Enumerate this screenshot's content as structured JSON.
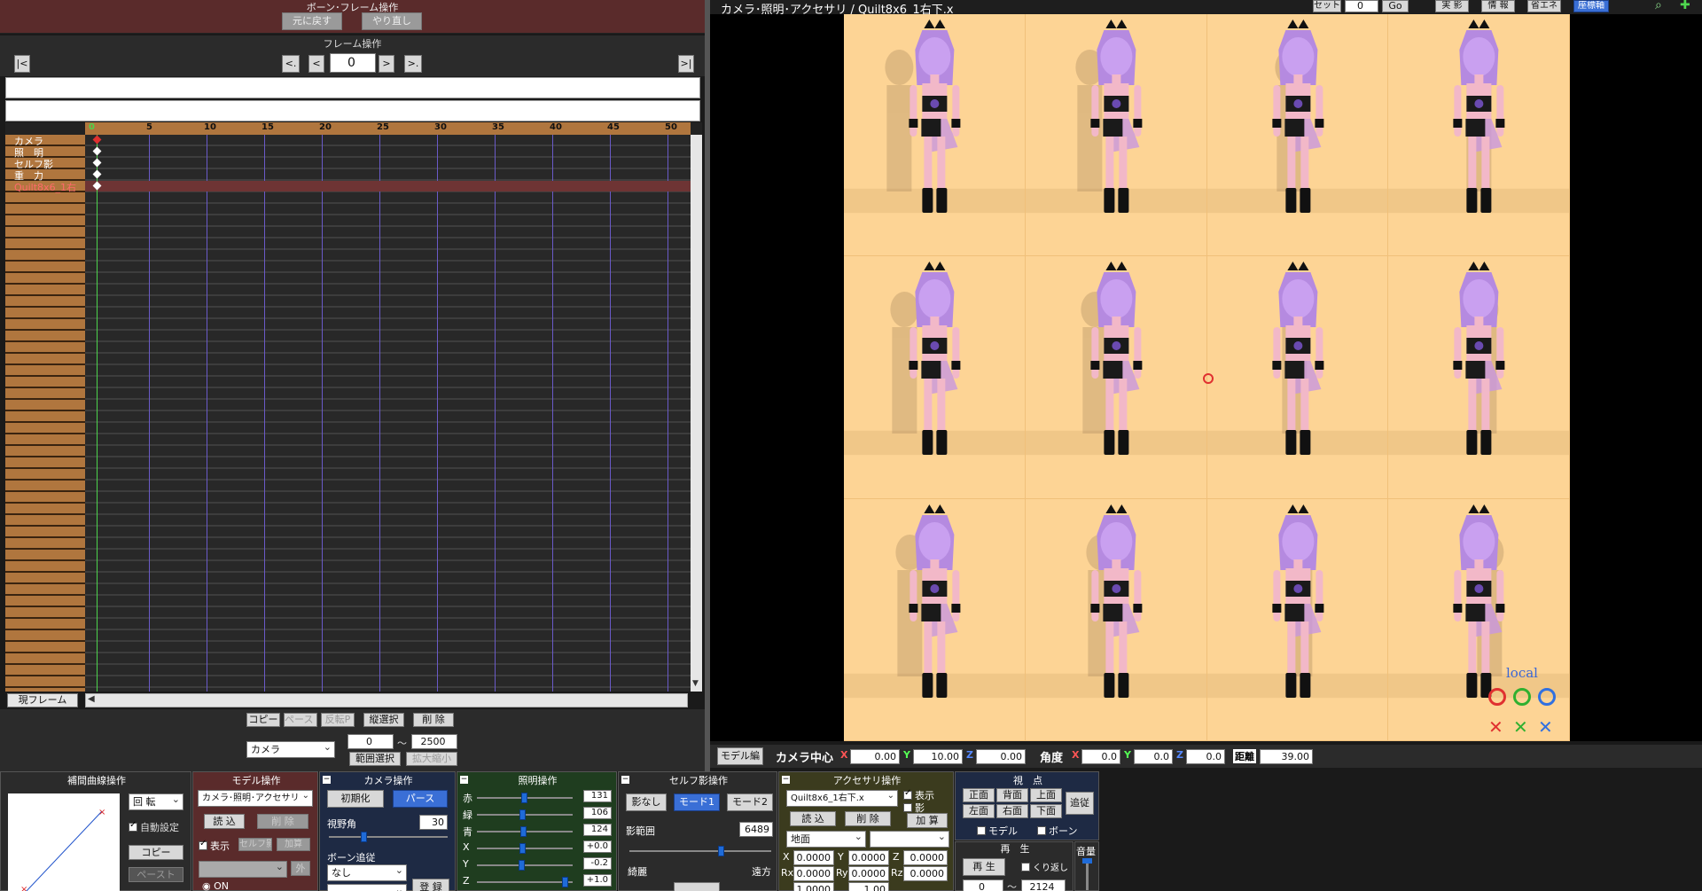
{
  "bone_frame_ops": {
    "title": "ボーン･フレーム操作",
    "undo": "元に戻す",
    "redo": "やり直し"
  },
  "frame_ops": {
    "title": "フレーム操作",
    "first": "|<",
    "prev_key": "<.",
    "prev": "<",
    "frame": "0",
    "next": ">",
    "next_key": ">.",
    "last": ">|"
  },
  "timeline": {
    "ruler": [
      "0",
      "5",
      "10",
      "15",
      "20",
      "25",
      "30",
      "35",
      "40",
      "45",
      "50"
    ],
    "tracks": [
      "カメラ",
      "照　明",
      "セルフ影",
      "重　力",
      "Quilt8x6_1右"
    ],
    "current_frame_label": "現フレーム"
  },
  "timeline_buttons": {
    "copy": "コピー",
    "paste": "ペースト",
    "invert_paste": "反転P",
    "vertical_select": "縦選択",
    "delete": "削 除",
    "target": "カメラ",
    "range_start": "0",
    "tilde": "〜",
    "range_end": "2500",
    "range_select": "範囲選択",
    "scale": "拡大縮小"
  },
  "viewport": {
    "title": "カメラ･照明･アクセサリ / Quilt8x6_1右下.x",
    "set_label": "セット",
    "set_value": "0",
    "go": "Go",
    "buttons": [
      "実 影",
      "情 報",
      "省エネ",
      "座標軸"
    ],
    "local_label": "local",
    "background": "#fdd495"
  },
  "camera_bar": {
    "model_edit": "モデル編",
    "camera_center": "カメラ中心",
    "x_label": "X",
    "x": "0.00",
    "y_label": "Y",
    "y": "10.00",
    "z_label": "Z",
    "z": "0.00",
    "angle_label": "角度",
    "ax": "0.0",
    "ay": "0.0",
    "az": "0.0",
    "distance_label": "距離",
    "distance": "39.00"
  },
  "interp_panel": {
    "title": "補間曲線操作",
    "rotation": "回 転",
    "auto_setting": "自動設定",
    "copy": "コピー",
    "paste": "ペースト"
  },
  "model_panel": {
    "title": "モデル操作",
    "model": "カメラ･照明･アクセサリ",
    "load": "読 込",
    "delete": "削 除",
    "show": "表示",
    "self_shadow": "セルフ影",
    "add": "加算",
    "out": "外",
    "on": "ON"
  },
  "camera_panel": {
    "title": "カメラ操作",
    "init": "初期化",
    "perspective": "パース",
    "fov_label": "視野角",
    "fov": "30",
    "bone_follow": "ボーン追従",
    "follow_target": "なし",
    "register": "登 録"
  },
  "light_panel": {
    "title": "照明操作",
    "labels": [
      "赤",
      "緑",
      "青",
      "X",
      "Y",
      "Z"
    ],
    "values": [
      "131",
      "106",
      "124",
      "+0.0",
      "-0.2",
      "+1.0"
    ]
  },
  "self_shadow_panel": {
    "title": "セルフ影操作",
    "none": "影なし",
    "mode1": "モード1",
    "mode2": "モード2",
    "range_label": "影範囲",
    "range": "6489",
    "near": "綺麗",
    "far": "遠方"
  },
  "accessory_panel": {
    "title": "アクセサリ操作",
    "accessory": "Quilt8x6_1右下.x",
    "show": "表示",
    "shadow": "影",
    "load": "読 込",
    "delete": "削 除",
    "add": "加 算",
    "parent": "地面",
    "x": "0.0000",
    "y": "0.0000",
    "z": "0.0000",
    "rx": "0.0000",
    "ry": "0.0000",
    "rz": "0.0000",
    "si": "1.0000",
    "tr": "1.00"
  },
  "view_panel": {
    "title": "視　点",
    "front": "正面",
    "back": "背面",
    "top": "上面",
    "left": "左面",
    "right": "右面",
    "bottom": "下面",
    "follow": "追従",
    "model": "モデル",
    "bone": "ボーン"
  },
  "play_panel": {
    "title": "再　生",
    "play": "再 生",
    "loop": "くり返し",
    "start": "0",
    "tilde": "〜",
    "end": "2124",
    "volume": "音量"
  }
}
